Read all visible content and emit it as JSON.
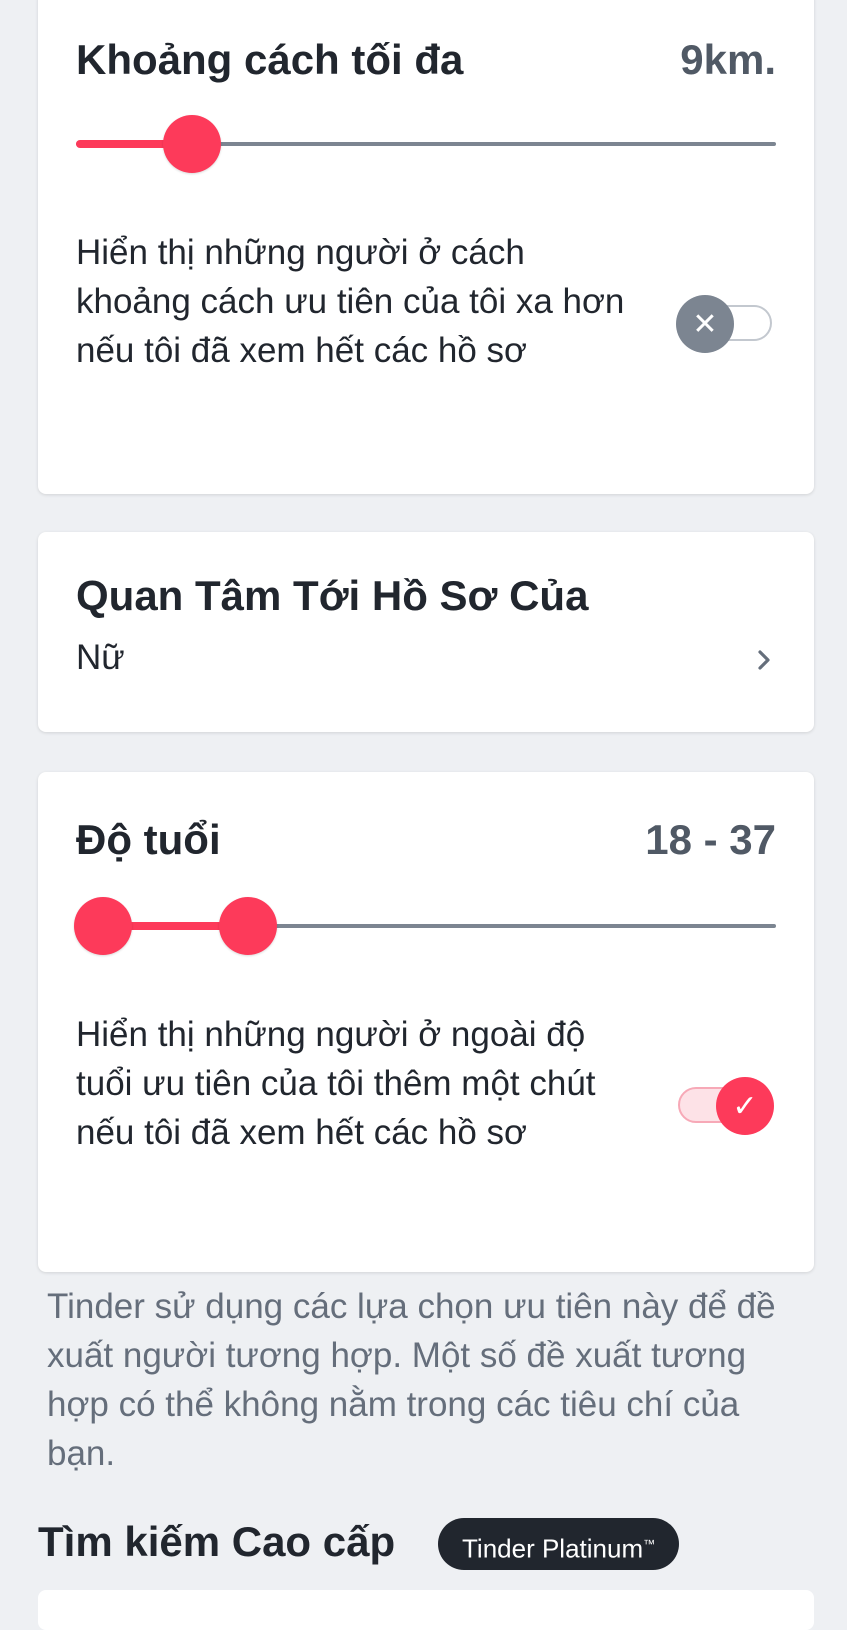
{
  "distance": {
    "title": "Khoảng cách tối đa",
    "value_label": "9km.",
    "slider_fraction": 0.09,
    "toggle_text": "Hiển thị những người ở cách khoảng cách ưu tiên của tôi xa hơn nếu tôi đã xem hết các hồ sơ",
    "toggle_on": false
  },
  "interest": {
    "title": "Quan Tâm Tới Hồ Sơ Của",
    "value": "Nữ"
  },
  "age": {
    "title": "Độ tuổi",
    "value_label": "18 - 37",
    "range_min": 18,
    "range_max": 37,
    "toggle_text": "Hiển thị những người ở ngoài độ tuổi ưu tiên của tôi thêm một chút nếu tôi đã xem hết các hồ sơ",
    "toggle_on": true
  },
  "footer_note": "Tinder sử dụng các lựa chọn ưu tiên này để đề xuất người tương hợp. Một số đề xuất tương hợp có thể không nằm trong các tiêu chí của bạn.",
  "advanced": {
    "title": "Tìm kiếm Cao cấp",
    "badge": "Tinder Platinum",
    "badge_tm": "™"
  },
  "colors": {
    "accent": "#fd3a5a",
    "track": "#7c8591",
    "badge_bg": "#21262e"
  },
  "icons": {
    "toggle_off": "x-icon",
    "toggle_on": "check-icon",
    "chevron": "chevron-right-icon"
  }
}
